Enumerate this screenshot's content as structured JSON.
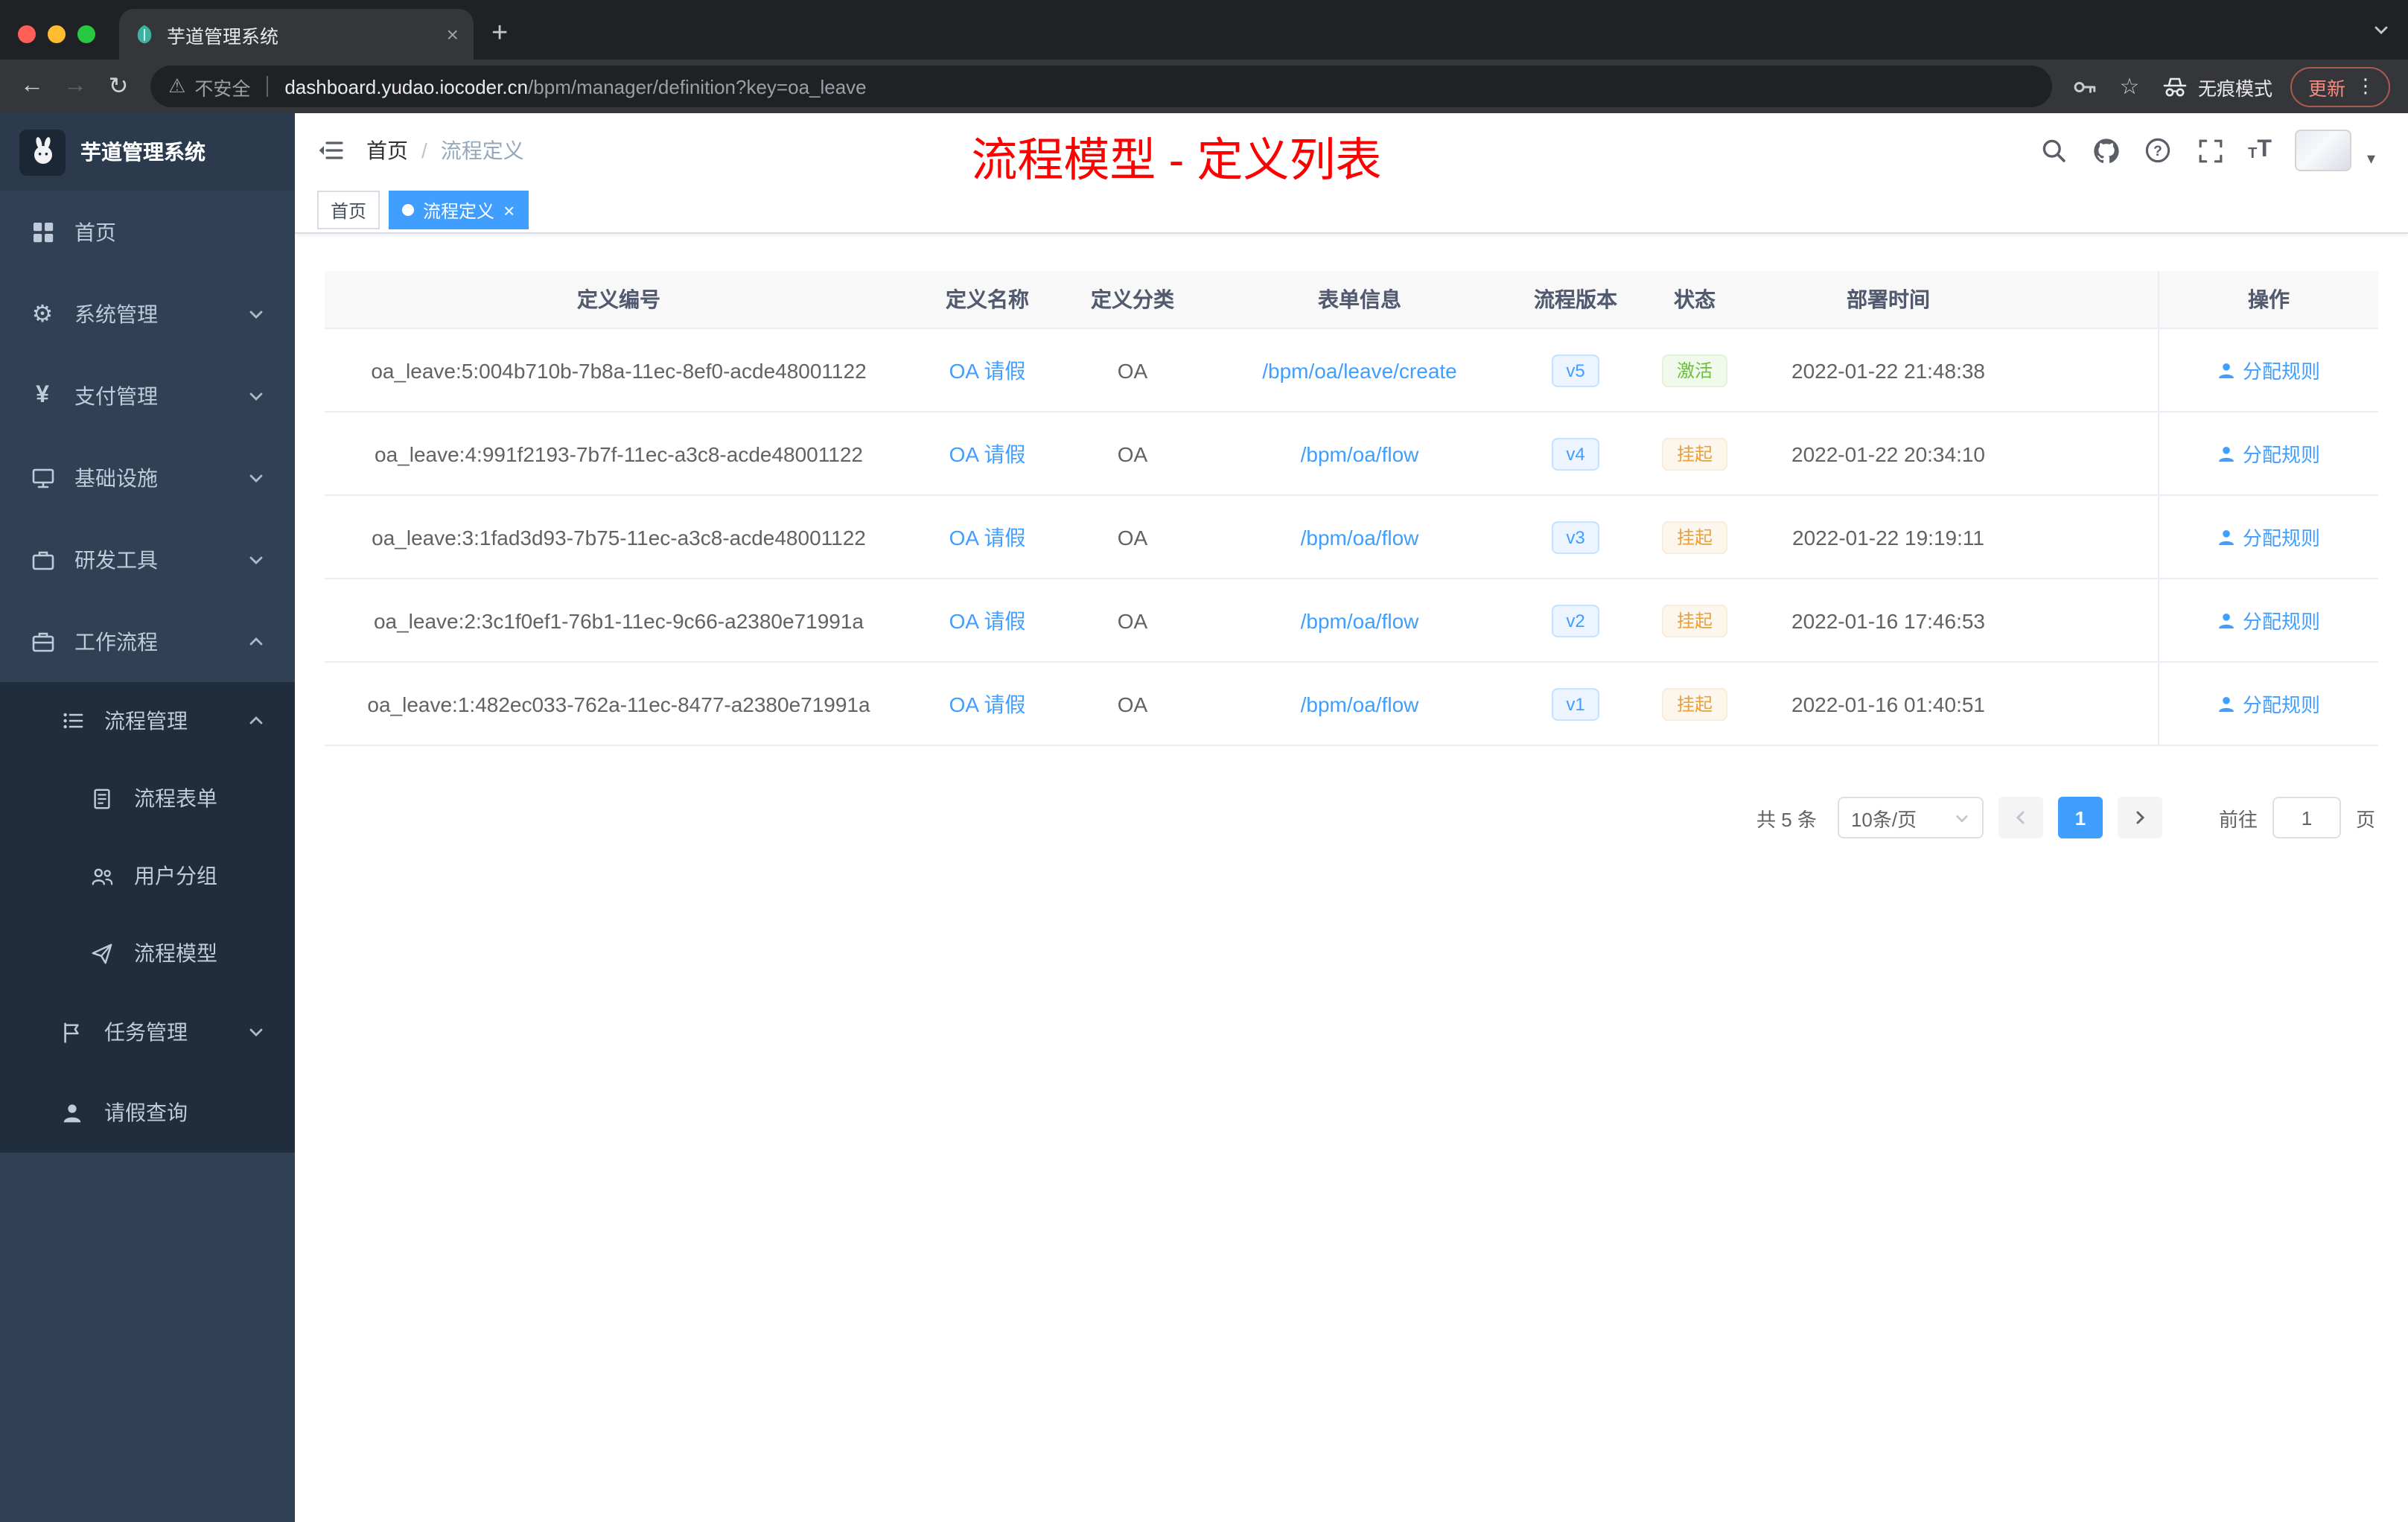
{
  "browser": {
    "tab_title": "芋道管理系统",
    "security_label": "不安全",
    "url_host": "dashboard.yudao.iocoder.cn",
    "url_path": "/bpm/manager/definition?key=oa_leave",
    "incognito_label": "无痕模式",
    "update_label": "更新"
  },
  "sidebar": {
    "title": "芋道管理系统",
    "menu": [
      {
        "label": "首页"
      },
      {
        "label": "系统管理"
      },
      {
        "label": "支付管理"
      },
      {
        "label": "基础设施"
      },
      {
        "label": "研发工具"
      },
      {
        "label": "工作流程"
      },
      {
        "label": "流程管理"
      },
      {
        "label": "流程表单"
      },
      {
        "label": "用户分组"
      },
      {
        "label": "流程模型"
      },
      {
        "label": "任务管理"
      },
      {
        "label": "请假查询"
      }
    ]
  },
  "header": {
    "breadcrumb_home": "首页",
    "breadcrumb_sep": "/",
    "breadcrumb_current": "流程定义",
    "annotation": "流程模型 - 定义列表"
  },
  "tags": {
    "home": "首页",
    "current": "流程定义"
  },
  "table": {
    "columns": [
      "定义编号",
      "定义名称",
      "定义分类",
      "表单信息",
      "流程版本",
      "状态",
      "部署时间",
      "操作"
    ],
    "rows": [
      {
        "id": "oa_leave:5:004b710b-7b8a-11ec-8ef0-acde48001122",
        "name": "OA 请假",
        "category": "OA",
        "form": "/bpm/oa/leave/create",
        "version": "v5",
        "status": "激活",
        "status_type": "success",
        "time": "2022-01-22 21:48:38",
        "action": "分配规则"
      },
      {
        "id": "oa_leave:4:991f2193-7b7f-11ec-a3c8-acde48001122",
        "name": "OA 请假",
        "category": "OA",
        "form": "/bpm/oa/flow",
        "version": "v4",
        "status": "挂起",
        "status_type": "warning",
        "time": "2022-01-22 20:34:10",
        "action": "分配规则"
      },
      {
        "id": "oa_leave:3:1fad3d93-7b75-11ec-a3c8-acde48001122",
        "name": "OA 请假",
        "category": "OA",
        "form": "/bpm/oa/flow",
        "version": "v3",
        "status": "挂起",
        "status_type": "warning",
        "time": "2022-01-22 19:19:11",
        "action": "分配规则"
      },
      {
        "id": "oa_leave:2:3c1f0ef1-76b1-11ec-9c66-a2380e71991a",
        "name": "OA 请假",
        "category": "OA",
        "form": "/bpm/oa/flow",
        "version": "v2",
        "status": "挂起",
        "status_type": "warning",
        "time": "2022-01-16 17:46:53",
        "action": "分配规则"
      },
      {
        "id": "oa_leave:1:482ec033-762a-11ec-8477-a2380e71991a",
        "name": "OA 请假",
        "category": "OA",
        "form": "/bpm/oa/flow",
        "version": "v1",
        "status": "挂起",
        "status_type": "warning",
        "time": "2022-01-16 01:40:51",
        "action": "分配规则"
      }
    ]
  },
  "pagination": {
    "total": "共 5 条",
    "page_size": "10条/页",
    "page": "1",
    "goto": "前往",
    "goto_value": "1",
    "unit": "页"
  },
  "colors": {
    "accent": "#409eff",
    "success": "#67c23a",
    "warning": "#e6a23c",
    "annotation": "#ff0000",
    "sidebar_bg": "#304156"
  }
}
